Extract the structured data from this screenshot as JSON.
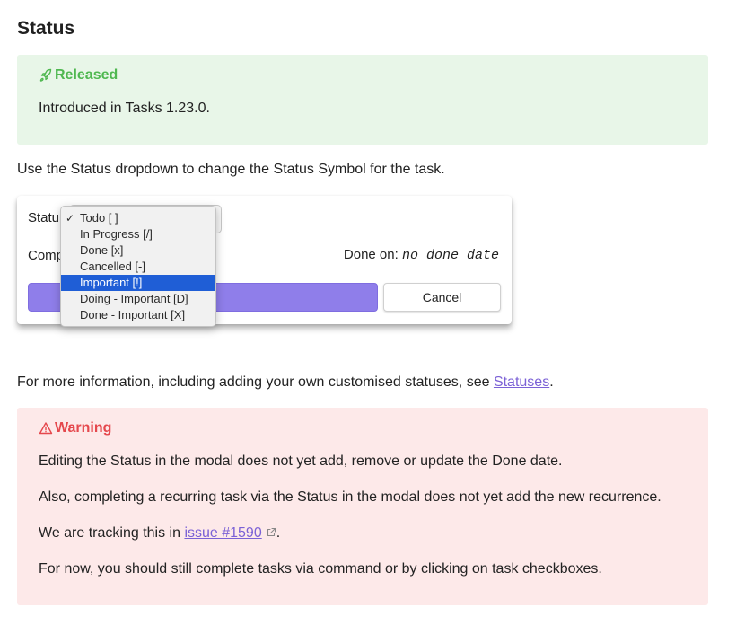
{
  "heading": "Status",
  "released_callout": {
    "title": "Released",
    "body": "Introduced in Tasks 1.23.0."
  },
  "intro_text": "Use the Status dropdown to change the Status Symbol for the task.",
  "modal": {
    "status_label": "Statu",
    "completed_label": "Comp",
    "done_on_label": "Done on:",
    "done_on_value": "no done date",
    "cancel_label": "Cancel"
  },
  "status_dropdown": {
    "options": [
      {
        "label": "Todo [ ]",
        "checked": true
      },
      {
        "label": "In Progress [/]"
      },
      {
        "label": "Done [x]"
      },
      {
        "label": "Cancelled [-]"
      },
      {
        "label": "Important [!]",
        "highlighted": true
      },
      {
        "label": "Doing - Important [D]"
      },
      {
        "label": "Done - Important [X]"
      }
    ]
  },
  "more_info": {
    "prefix": "For more information, including adding your own customised statuses, see ",
    "link": "Statuses",
    "suffix": "."
  },
  "warning_callout": {
    "title": "Warning",
    "p1": "Editing the Status in the modal does not yet add, remove or update the Done date.",
    "p2": "Also, completing a recurring task via the Status in the modal does not yet add the new recurrence.",
    "p3_prefix": "We are tracking this in ",
    "p3_link": "issue #1590",
    "p3_suffix": ".",
    "p4": "For now, you should still complete tasks via command or by clicking on task checkboxes."
  },
  "colors": {
    "success_accent": "#4fb850",
    "warning_accent": "#e5484d",
    "link": "#7b61d6",
    "primary_button": "#8f7eea",
    "dropdown_highlight": "#1f5ed6"
  }
}
